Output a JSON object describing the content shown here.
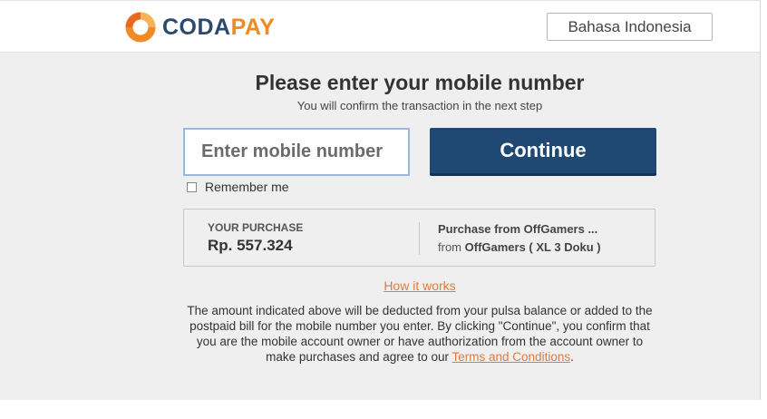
{
  "header": {
    "logo_text_part1": "CODA",
    "logo_text_part2": "PAY",
    "language_button": "Bahasa Indonesia"
  },
  "form": {
    "title": "Please enter your mobile number",
    "subtitle": "You will confirm the transaction in the next step",
    "phone_placeholder": "Enter mobile number",
    "continue_label": "Continue",
    "remember_label": "Remember me",
    "remember_checked": false
  },
  "purchase": {
    "label": "YOUR PURCHASE",
    "amount": "Rp. 557.324",
    "item": "Purchase from OffGamers ...",
    "from_prefix": "from",
    "merchant": "OffGamers ( XL 3 Doku )"
  },
  "how_it_works": "How it works",
  "disclaimer": {
    "text": "The amount indicated above will be deducted from your pulsa balance or added to the postpaid bill for the mobile number you enter. By clicking \"Continue\", you confirm that you are the mobile account owner or have authorization from the account owner to make purchases and agree to our",
    "terms_link": "Terms and Conditions",
    "end": "."
  },
  "colors": {
    "brand_blue": "#1f4873",
    "brand_orange": "#f08a24",
    "link_orange": "#e07a3f",
    "background_gray": "#efefef"
  },
  "icons": {
    "logo": "codapay-ring-logo-icon"
  }
}
